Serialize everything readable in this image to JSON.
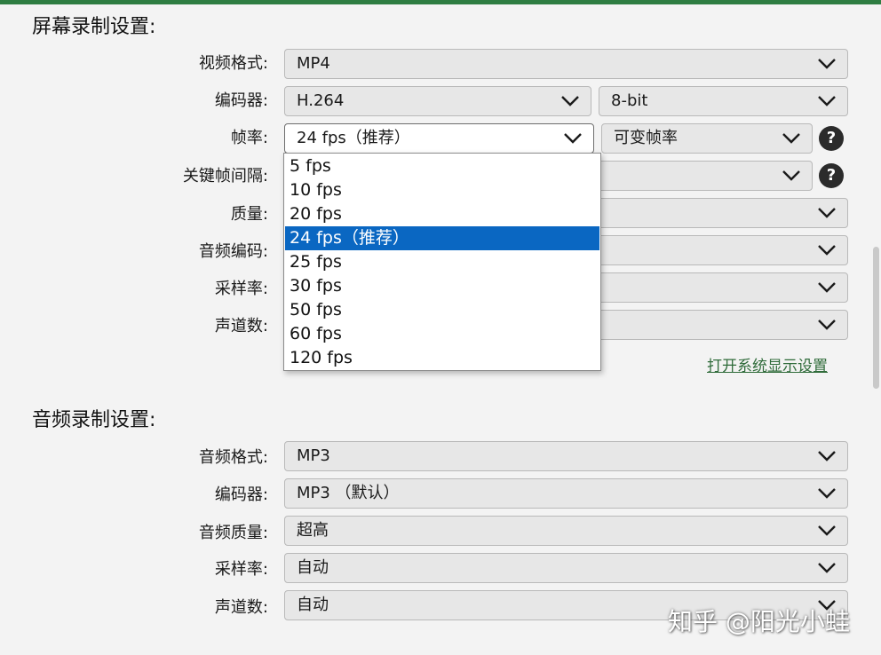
{
  "screen_section": {
    "title": "屏幕录制设置:",
    "rows": [
      {
        "label": "视频格式:",
        "value": "MP4"
      },
      {
        "label": "编码器:",
        "value": "H.264",
        "value2": "8-bit"
      },
      {
        "label": "帧率:",
        "value": "24 fps（推荐）",
        "value2": "可变帧率"
      },
      {
        "label": "关键帧间隔:",
        "value": ""
      },
      {
        "label": "质量:",
        "value": ""
      },
      {
        "label": "音频编码:",
        "value": ""
      },
      {
        "label": "采样率:",
        "value": ""
      },
      {
        "label": "声道数:",
        "value": ""
      }
    ],
    "framerate_options": [
      "5 fps",
      "10 fps",
      "20 fps",
      "24 fps（推荐）",
      "25 fps",
      "30 fps",
      "50 fps",
      "60 fps",
      "120 fps"
    ],
    "selected_option_index": 3,
    "display_settings_link": "打开系统显示设置"
  },
  "audio_section": {
    "title": "音频录制设置:",
    "rows": [
      {
        "label": "音频格式:",
        "value": "MP3"
      },
      {
        "label": "编码器:",
        "value": "MP3 （默认）"
      },
      {
        "label": "音频质量:",
        "value": "超高"
      },
      {
        "label": "采样率:",
        "value": "自动"
      },
      {
        "label": "声道数:",
        "value": "自动"
      }
    ]
  },
  "help_symbol": "?",
  "watermark": "知乎 @阳光小蛙",
  "colors": {
    "accent_green": "#2e7d42",
    "selection_blue": "#0a67c2",
    "link_green": "#2f6b3a"
  }
}
